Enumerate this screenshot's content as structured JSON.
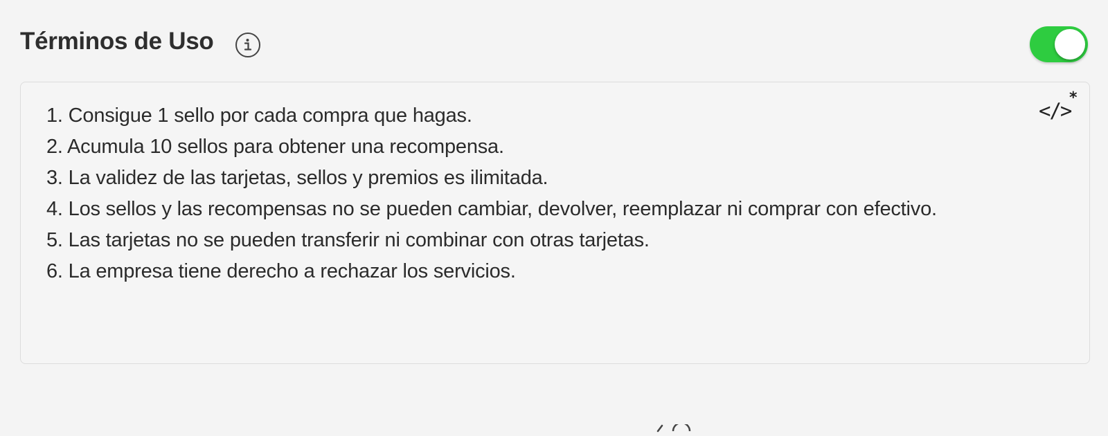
{
  "section": {
    "title": "Términos de Uso",
    "enabled": true
  },
  "icons": {
    "info": "info-circle-icon",
    "code": "code-tags-icon",
    "code_asterisk": "*"
  },
  "terms": {
    "lines": [
      "1. Consigue 1 sello por cada compra que hagas.",
      "2. Acumula 10 sellos para obtener una recompensa.",
      "3. La validez de las tarjetas, sellos y premios es ilimitada.",
      "4. Los sellos y las recompensas no se pueden cambiar, devolver, reemplazar ni comprar con efectivo.",
      "5. Las tarjetas no se pueden transferir ni combinar con otras tarjetas.",
      "6. La empresa tiene derecho a rechazar los servicios."
    ]
  },
  "colors": {
    "toggle_on": "#2ecc40",
    "background": "#f4f4f4",
    "text": "#2b2b2b"
  }
}
